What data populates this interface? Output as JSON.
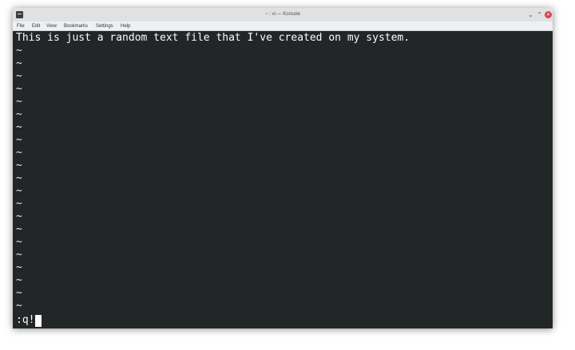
{
  "window": {
    "title": "~ : vi — Konsole",
    "min_glyph": "⌄",
    "max_glyph": "⌃",
    "close_glyph": "✕"
  },
  "menu": {
    "items": [
      "File",
      "Edit",
      "View",
      "Bookmarks",
      "Settings",
      "Help"
    ]
  },
  "editor": {
    "text_line": "This is just a random text file that I've created on my system.",
    "empty_line_marker": "~",
    "empty_line_count": 21,
    "command_line": ":q!"
  },
  "colors": {
    "terminal_bg": "#232627",
    "text": "#fcfcfc",
    "close_button": "#da4453"
  }
}
